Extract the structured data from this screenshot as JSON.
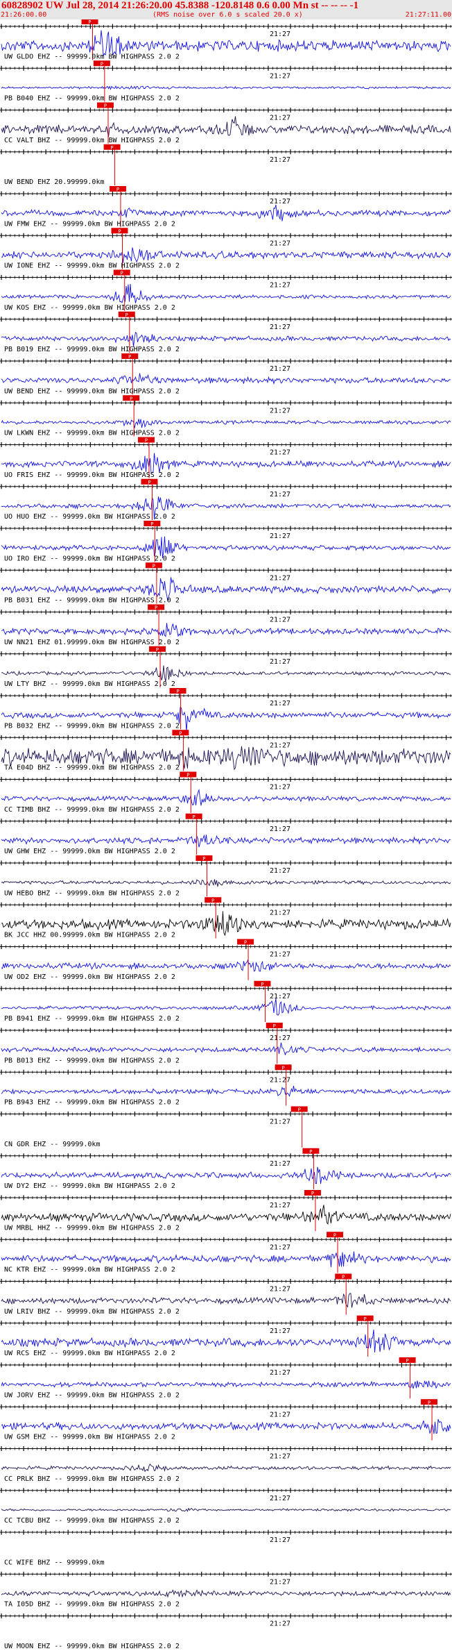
{
  "header": {
    "title": "60828902 UW Jul 28, 2014 21:26:20.00   45.8388 -120.8148  0.6 0.00 Mn st -- -- --  -1",
    "subtitle": "(RMS noise over 6.0 s scaled 20.0 x)",
    "time_start": "21:26:00.00",
    "time_end": "21:27:11.00"
  },
  "chart_data": {
    "type": "line",
    "title": "60828902 UW Jul 28, 2014 21:26:20.00   45.8388 -120.8148  0.6 0.00 Mn st -- -- --  -1",
    "xlim": [
      "21:26:00.00",
      "21:27:11.00"
    ],
    "minute_label": "21:27",
    "pick_marker_text": "P",
    "colors": {
      "blue": "#1010e0",
      "navy": "#1a1050",
      "black": "#000000",
      "pick": "#e00000",
      "axis": "#000000"
    },
    "traces": [
      {
        "label": "UW GLDO EHZ -- 99999.0km BW  HIGHPASS  2.0  2",
        "color": "blue",
        "pick_s": 20.5,
        "amp": 9,
        "burst_s": 25,
        "burst_amp": 18
      },
      {
        "label": "PB B040 EHZ -- 99999.0km BW  HIGHPASS  2.0  2",
        "color": "blue",
        "pick_s": 23.2,
        "amp": 2,
        "burst_s": 30,
        "burst_amp": 2
      },
      {
        "label": "CC VALT BHZ -- 99999.0km BW  HIGHPASS  2.0  2",
        "color": "navy",
        "pick_s": 24.0,
        "amp": 7,
        "burst_s": 52,
        "burst_amp": 14
      },
      {
        "label": "UW BEND EHZ 20.99999.0km",
        "color": "blue",
        "pick_s": 25.5,
        "amp": 0,
        "burst_s": 30,
        "burst_amp": 0
      },
      {
        "label": "UW FMW EHZ -- 99999.0km BW  HIGHPASS  2.0  2",
        "color": "blue",
        "pick_s": 26.8,
        "amp": 5,
        "burst_s": 62,
        "burst_amp": 12
      },
      {
        "label": "UW IONE EHZ -- 99999.0km BW  HIGHPASS  2.0  2",
        "color": "blue",
        "pick_s": 27.2,
        "amp": 6,
        "burst_s": 30,
        "burst_amp": 8
      },
      {
        "label": "UW KOS EHZ -- 99999.0km BW  HIGHPASS  2.0  2",
        "color": "blue",
        "pick_s": 27.7,
        "amp": 3,
        "burst_s": 29,
        "burst_amp": 14
      },
      {
        "label": "PB B019 EHZ -- 99999.0km BW  HIGHPASS  2.0  2",
        "color": "blue",
        "pick_s": 28.8,
        "amp": 4,
        "burst_s": 30,
        "burst_amp": 10
      },
      {
        "label": "UW BEND EHZ -- 99999.0km BW  HIGHPASS  2.0  2",
        "color": "blue",
        "pick_s": 29.5,
        "amp": 5,
        "burst_s": 31,
        "burst_amp": 8
      },
      {
        "label": "UW LKWN EHZ -- 99999.0km BW  HIGHPASS  2.0  2",
        "color": "blue",
        "pick_s": 29.8,
        "amp": 3,
        "burst_s": 31,
        "burst_amp": 6
      },
      {
        "label": "UO FRIS EHZ -- 99999.0km BW  HIGHPASS  2.0  2",
        "color": "blue",
        "pick_s": 33.2,
        "amp": 5,
        "burst_s": 34,
        "burst_amp": 18
      },
      {
        "label": "UO HUO EHZ -- 99999.0km BW  HIGHPASS  2.0  2",
        "color": "blue",
        "pick_s": 33.9,
        "amp": 4,
        "burst_s": 35,
        "burst_amp": 16
      },
      {
        "label": "UO IRO EHZ -- 99999.0km BW  HIGHPASS  2.0  2",
        "color": "blue",
        "pick_s": 34.5,
        "amp": 4,
        "burst_s": 36,
        "burst_amp": 20
      },
      {
        "label": "PB B031 EHZ -- 99999.0km BW  HIGHPASS  2.0  2",
        "color": "blue",
        "pick_s": 34.9,
        "amp": 6,
        "burst_s": 37,
        "burst_amp": 18
      },
      {
        "label": "UW NN21 EHZ 01.99999.0km BW  HIGHPASS  2.0  2",
        "color": "blue",
        "pick_s": 35.4,
        "amp": 5,
        "burst_s": 38,
        "burst_amp": 10
      },
      {
        "label": "UW LTY BHZ -- 99999.0km BW  HIGHPASS  2.0  2",
        "color": "navy",
        "pick_s": 35.7,
        "amp": 3,
        "burst_s": 37,
        "burst_amp": 10
      },
      {
        "label": "PB B032 EHZ -- 99999.0km BW  HIGHPASS  2.0  2",
        "color": "blue",
        "pick_s": 40.3,
        "amp": 5,
        "burst_s": 42,
        "burst_amp": 16
      },
      {
        "label": "TA E04D BHZ -- 99999.0km BW  HIGHPASS  2.0  2",
        "color": "navy",
        "pick_s": 40.9,
        "amp": 14,
        "burst_s": 55,
        "burst_amp": 18
      },
      {
        "label": "CC TIMB BHZ -- 99999.0km BW  HIGHPASS  2.0  2",
        "color": "blue",
        "pick_s": 42.6,
        "amp": 4,
        "burst_s": 44,
        "burst_amp": 10
      },
      {
        "label": "UW GHW EHZ -- 99999.0km BW  HIGHPASS  2.0  2",
        "color": "blue",
        "pick_s": 43.9,
        "amp": 5,
        "burst_s": 45,
        "burst_amp": 8
      },
      {
        "label": "UW HEBO BHZ -- 99999.0km BW  HIGHPASS  2.0  2",
        "color": "navy",
        "pick_s": 46.2,
        "amp": 3,
        "burst_s": 47,
        "burst_amp": 5
      },
      {
        "label": "BK JCC HHZ 00.99999.0km BW  HIGHPASS  2.0  2",
        "color": "black",
        "pick_s": 48.2,
        "amp": 8,
        "burst_s": 50,
        "burst_amp": 18
      },
      {
        "label": "UW OD2 EHZ -- 99999.0km BW  HIGHPASS  2.0  2",
        "color": "blue",
        "pick_s": 55.5,
        "amp": 5,
        "burst_s": 57,
        "burst_amp": 8
      },
      {
        "label": "PB B941 EHZ -- 99999.0km BW  HIGHPASS  2.0  2",
        "color": "blue",
        "pick_s": 59.3,
        "amp": 3,
        "burst_s": 62,
        "burst_amp": 14
      },
      {
        "label": "PB B013 EHZ -- 99999.0km BW  HIGHPASS  2.0  2",
        "color": "blue",
        "pick_s": 62.0,
        "amp": 4,
        "burst_s": 64,
        "burst_amp": 6
      },
      {
        "label": "PB B943 EHZ -- 99999.0km BW  HIGHPASS  2.0  2",
        "color": "blue",
        "pick_s": 64.0,
        "amp": 4,
        "burst_s": 65,
        "burst_amp": 6
      },
      {
        "label": "CN GDR EHZ -- 99999.0km",
        "color": "blue",
        "pick_s": 67.6,
        "amp": 0,
        "burst_s": 68,
        "burst_amp": 0
      },
      {
        "label": "UW DY2 EHZ -- 99999.0km BW  HIGHPASS  2.0  2",
        "color": "blue",
        "pick_s": 70.2,
        "amp": 5,
        "burst_s": 71,
        "burst_amp": 10
      },
      {
        "label": "UW MRBL HHZ -- 99999.0km BW  HIGHPASS  2.0  2",
        "color": "black",
        "pick_s": 70.6,
        "amp": 7,
        "burst_s": 72,
        "burst_amp": 14
      },
      {
        "label": "NC KTR EHZ -- 99999.0km BW  HIGHPASS  2.0  2",
        "color": "blue",
        "pick_s": 75.6,
        "amp": 6,
        "burst_s": 77,
        "burst_amp": 12
      },
      {
        "label": "UW LRIV BHZ -- 99999.0km BW  HIGHPASS  2.0  2",
        "color": "navy",
        "pick_s": 77.5,
        "amp": 5,
        "burst_s": 79,
        "burst_amp": 12
      },
      {
        "label": "UW RCS EHZ -- 99999.0km BW  HIGHPASS  2.0  2",
        "color": "blue",
        "pick_s": 82.4,
        "amp": 7,
        "burst_s": 84,
        "burst_amp": 14
      },
      {
        "label": "UW JORV EHZ -- 99999.0km BW  HIGHPASS  2.0  2",
        "color": "blue",
        "pick_s": 91.9,
        "amp": 4,
        "burst_s": 95,
        "burst_amp": 4
      },
      {
        "label": "UW GSM EHZ -- 99999.0km BW  HIGHPASS  2.0  2",
        "color": "blue",
        "pick_s": 96.8,
        "amp": 6,
        "burst_s": 99,
        "burst_amp": 10
      },
      {
        "label": "CC PRLK BHZ -- 99999.0km BW  HIGHPASS  2.0  2",
        "color": "navy",
        "pick_s": null,
        "amp": 3,
        "burst_s": 33,
        "burst_amp": 5
      },
      {
        "label": "CC TCBU BHZ -- 99999.0km BW  HIGHPASS  2.0  2",
        "color": "navy",
        "pick_s": null,
        "amp": 2,
        "burst_s": 40,
        "burst_amp": 2
      },
      {
        "label": "CC WIFE BHZ -- 99999.0km",
        "color": "blue",
        "pick_s": null,
        "amp": 0,
        "burst_s": 40,
        "burst_amp": 0
      },
      {
        "label": "TA I05D BHZ -- 99999.0km BW  HIGHPASS  2.0  2",
        "color": "navy",
        "pick_s": null,
        "amp": 4,
        "burst_s": 40,
        "burst_amp": 4
      },
      {
        "label": "UW MOON EHZ -- 99999.0km BW  HIGHPASS  2.0  2",
        "color": "blue",
        "pick_s": null,
        "amp": 0,
        "burst_s": 40,
        "burst_amp": 0
      }
    ]
  }
}
